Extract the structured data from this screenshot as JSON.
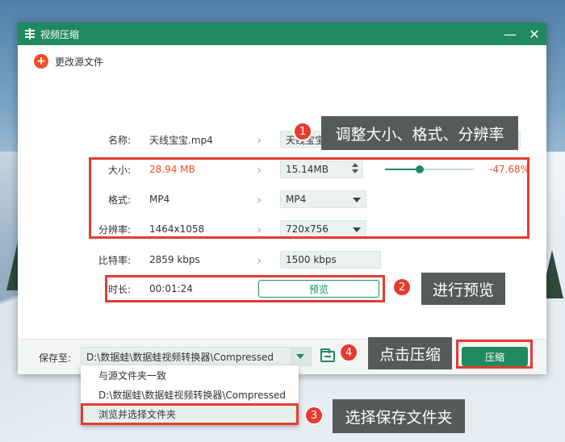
{
  "window": {
    "title": "视频压缩",
    "minimize": "—",
    "close": "✕"
  },
  "change_source": {
    "label": "更改源文件"
  },
  "rows": {
    "name": {
      "label": "名称:",
      "orig": "天线宝宝.mp4",
      "new": "天线宝宝(Compressed).mp4"
    },
    "size": {
      "label": "大小:",
      "orig": "28.94 MB",
      "new": "15.14MB",
      "percent": "-47.68%",
      "slider_value": 0.39
    },
    "format": {
      "label": "格式:",
      "orig": "MP4",
      "new": "MP4"
    },
    "resolution": {
      "label": "分辨率:",
      "orig": "1464x1058",
      "new": "720x756"
    },
    "bitrate": {
      "label": "比特率:",
      "orig": "2859 kbps",
      "new": "1500 kbps"
    },
    "duration": {
      "label": "时长:",
      "orig": "00:01:24",
      "preview": "预览"
    }
  },
  "bottom": {
    "save_label": "保存至:",
    "save_path": "D:\\数据蛙\\数据蛙视频转换器\\Compressed",
    "compress": "压缩"
  },
  "menu": {
    "items": [
      "与源文件夹一致",
      "D:\\数据蛙\\数据蛙视频转换器\\Compressed",
      "浏览并选择文件夹"
    ]
  },
  "callouts": {
    "c1": {
      "num": "1",
      "text": "调整大小、格式、分辨率"
    },
    "c2": {
      "num": "2",
      "text": "进行预览"
    },
    "c3": {
      "num": "3",
      "text": "选择保存文件夹"
    },
    "c4": {
      "num": "4",
      "text": "点击压缩"
    }
  },
  "colors": {
    "accent": "#1f8a5f",
    "warn": "#f04e23",
    "callout_red": "#e63b30"
  }
}
